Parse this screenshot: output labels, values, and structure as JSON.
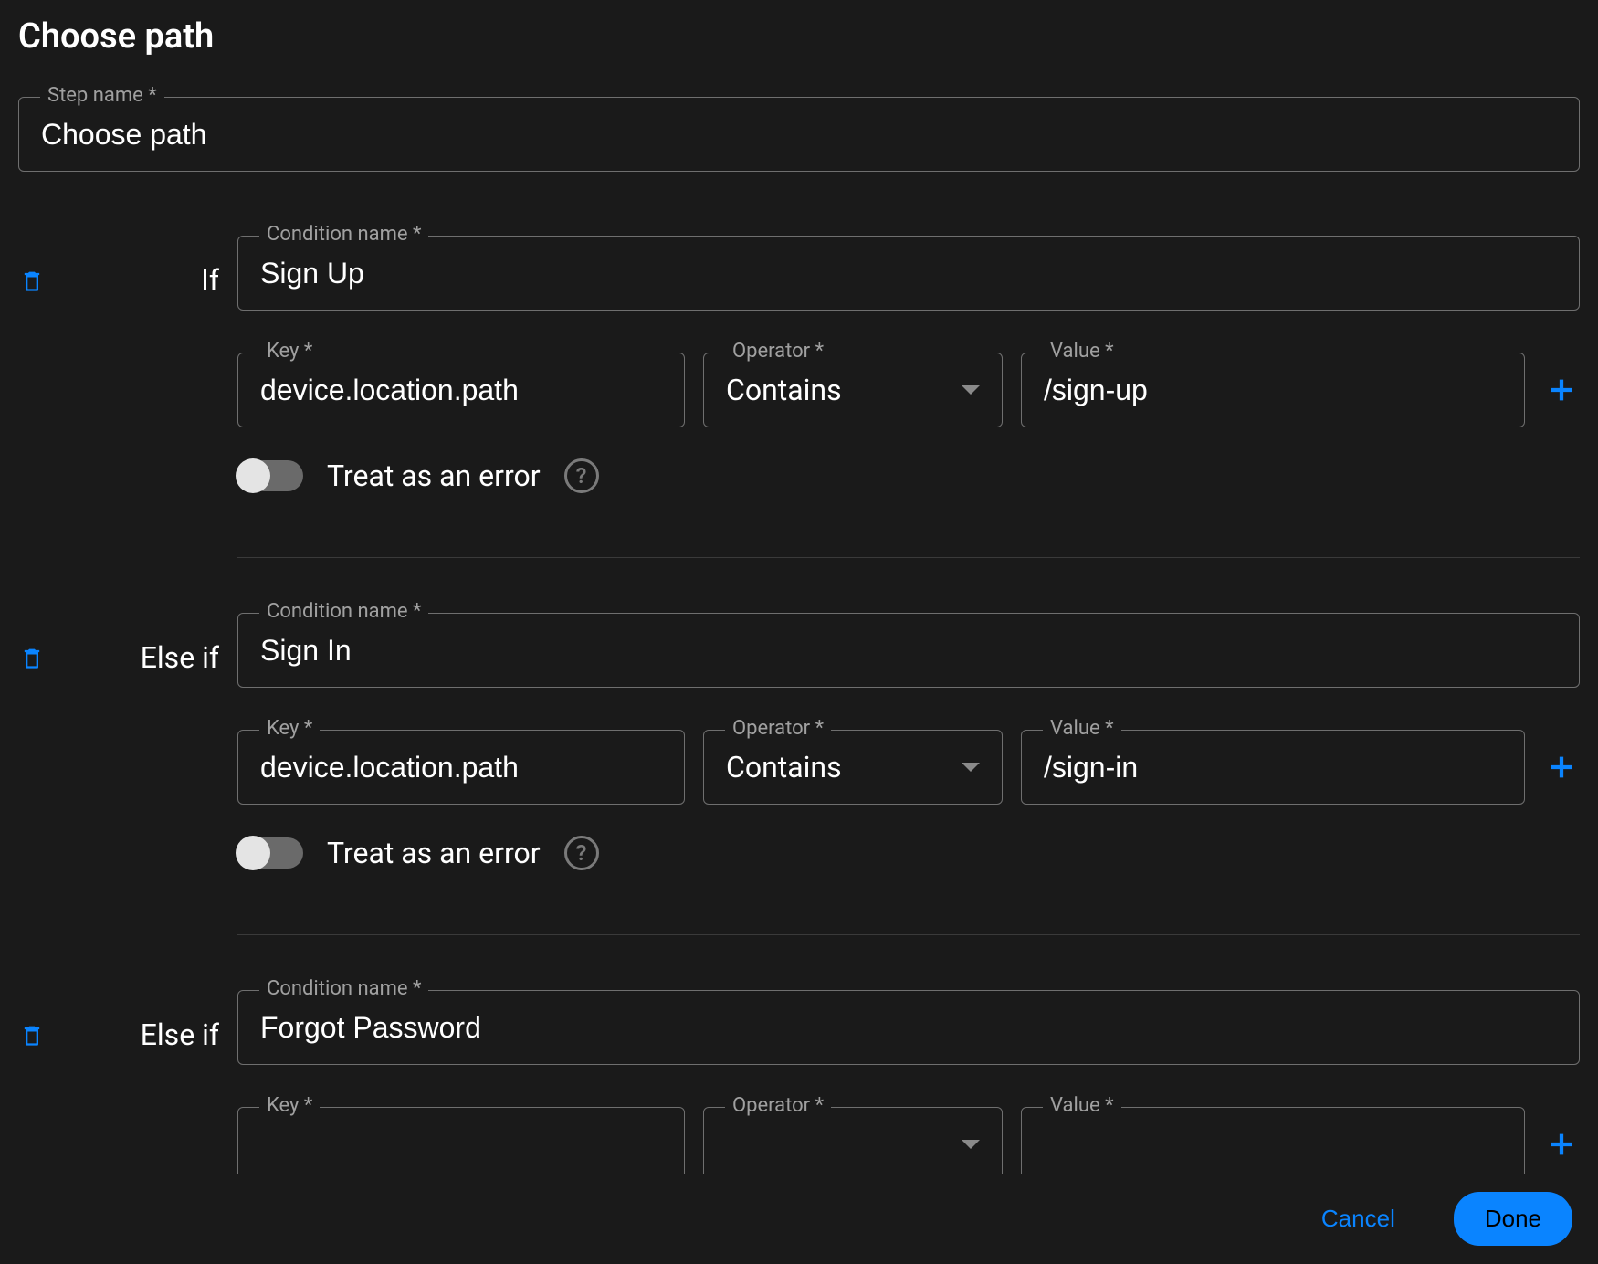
{
  "panel_title": "Choose path",
  "step_name": {
    "label": "Step name *",
    "value": "Choose path"
  },
  "labels": {
    "condition_name": "Condition name *",
    "key": "Key *",
    "operator": "Operator *",
    "value": "Value *",
    "treat_as_error": "Treat as an error",
    "cancel": "Cancel",
    "done": "Done"
  },
  "conditions": [
    {
      "prefix": "If",
      "name": "Sign Up",
      "rule": {
        "key": "device.location.path",
        "operator": "Contains",
        "value": "/sign-up"
      },
      "treat_as_error": false
    },
    {
      "prefix": "Else if",
      "name": "Sign In",
      "rule": {
        "key": "device.location.path",
        "operator": "Contains",
        "value": "/sign-in"
      },
      "treat_as_error": false
    },
    {
      "prefix": "Else if",
      "name": "Forgot Password",
      "rule": {
        "key": "",
        "operator": "",
        "value": ""
      },
      "treat_as_error": false
    }
  ],
  "colors": {
    "accent": "#0a84ff",
    "bg": "#1a1a1a"
  }
}
